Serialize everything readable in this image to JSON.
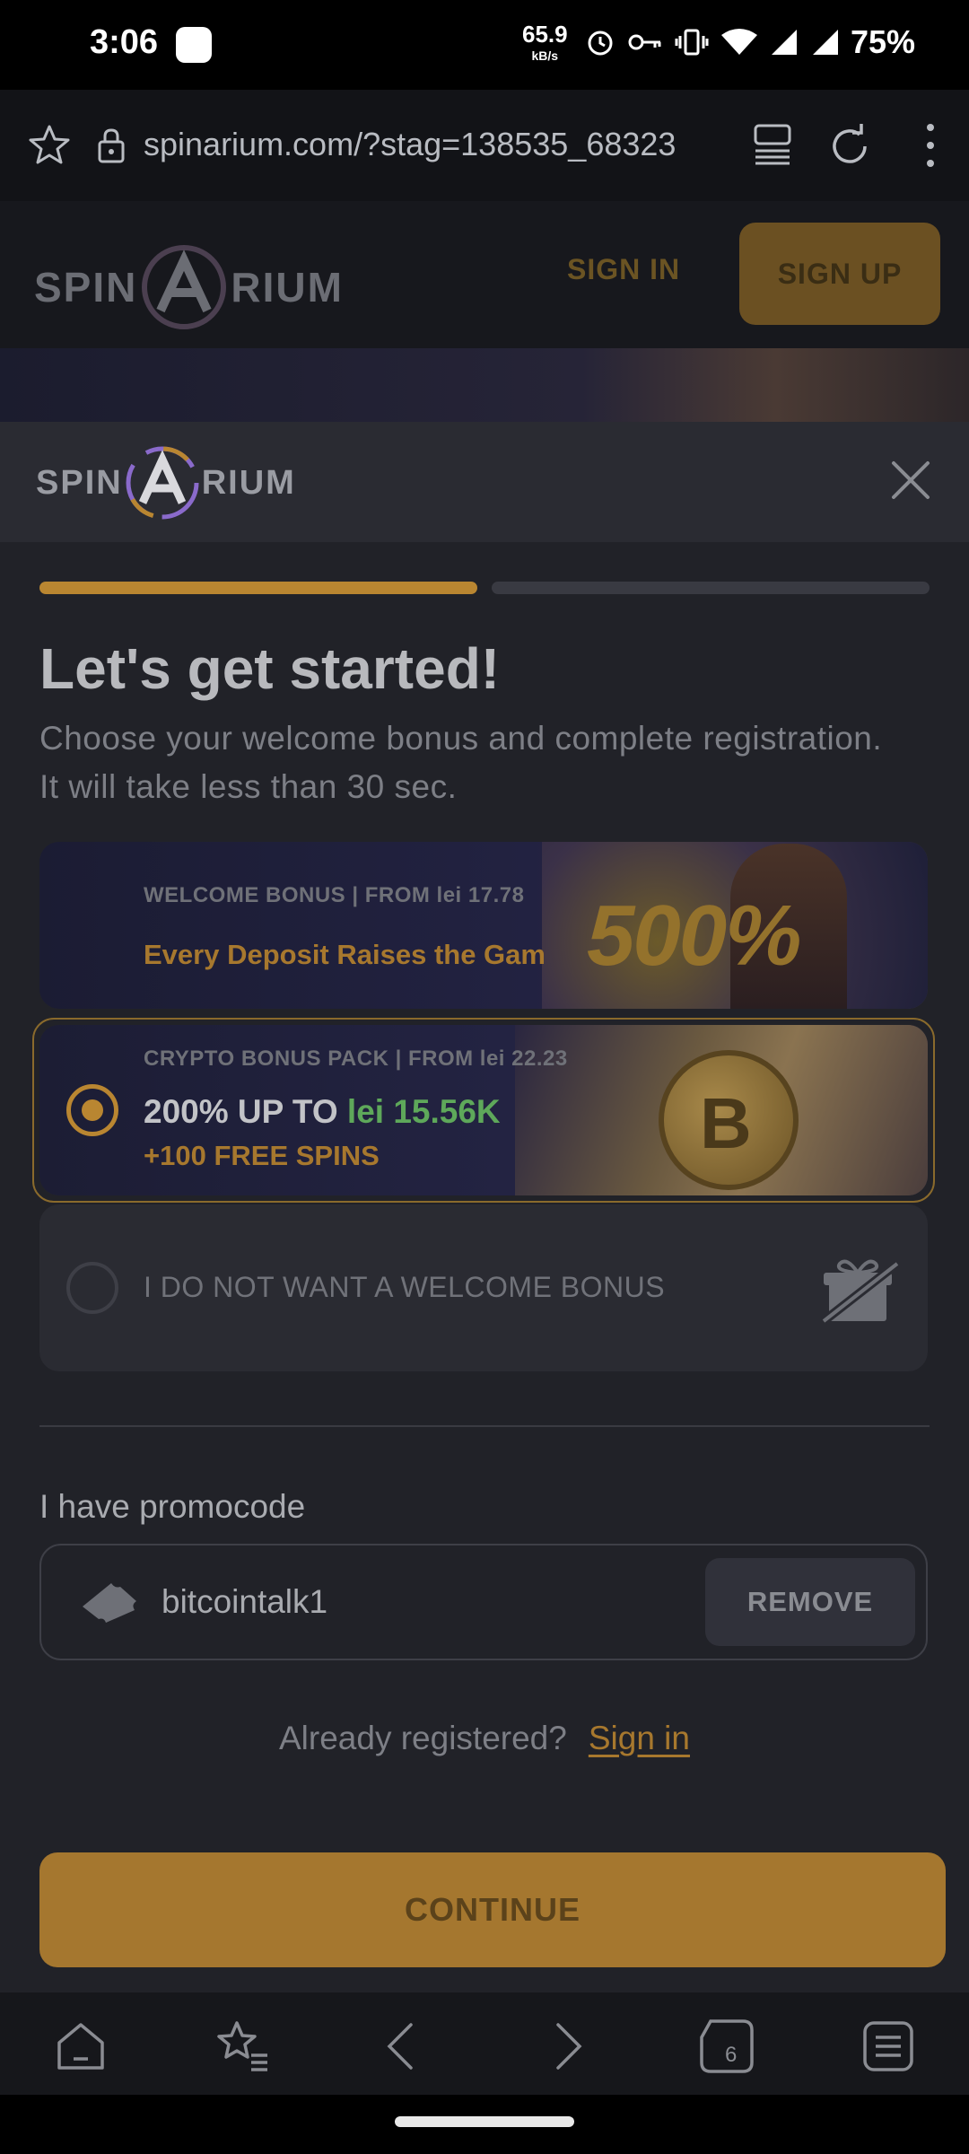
{
  "status_bar": {
    "time": "3:06",
    "net_speed": "65.9",
    "net_unit": "kB/s",
    "battery": "75%"
  },
  "browser": {
    "url": "spinarium.com/?stag=138535_68323",
    "tab_count": "6"
  },
  "site_header": {
    "logo_left": "SPIN",
    "logo_right": "RIUM",
    "sign_in": "SIGN IN",
    "sign_up": "SIGN UP"
  },
  "modal": {
    "logo_left": "SPIN",
    "logo_right": "RIUM",
    "progress_step": 1,
    "progress_total": 2,
    "title": "Let's get started!",
    "subtitle": "Choose your welcome bonus and complete registration. It will take less than 30 sec.",
    "bonuses": [
      {
        "label": "WELCOME BONUS | FROM lei 17.78",
        "title": "Every Deposit Raises the Gam",
        "badge": "500%",
        "selected": false
      },
      {
        "label": "CRYPTO BONUS PACK | FROM lei 22.23",
        "title_prefix": "200% UP TO ",
        "title_amount": "lei 15.56K",
        "subtitle": "+100 FREE SPINS",
        "coin": "B",
        "selected": true
      },
      {
        "title": "I DO NOT WANT A WELCOME BONUS",
        "selected": false
      }
    ],
    "promo": {
      "label": "I have promocode",
      "value": "bitcointalk1",
      "remove": "REMOVE"
    },
    "already_registered": "Already registered?",
    "sign_in_link": "Sign in",
    "continue": "CONTINUE"
  },
  "colors": {
    "accent": "#b98631",
    "highlight_green": "#5ea85a",
    "modal_bg": "#212228"
  }
}
